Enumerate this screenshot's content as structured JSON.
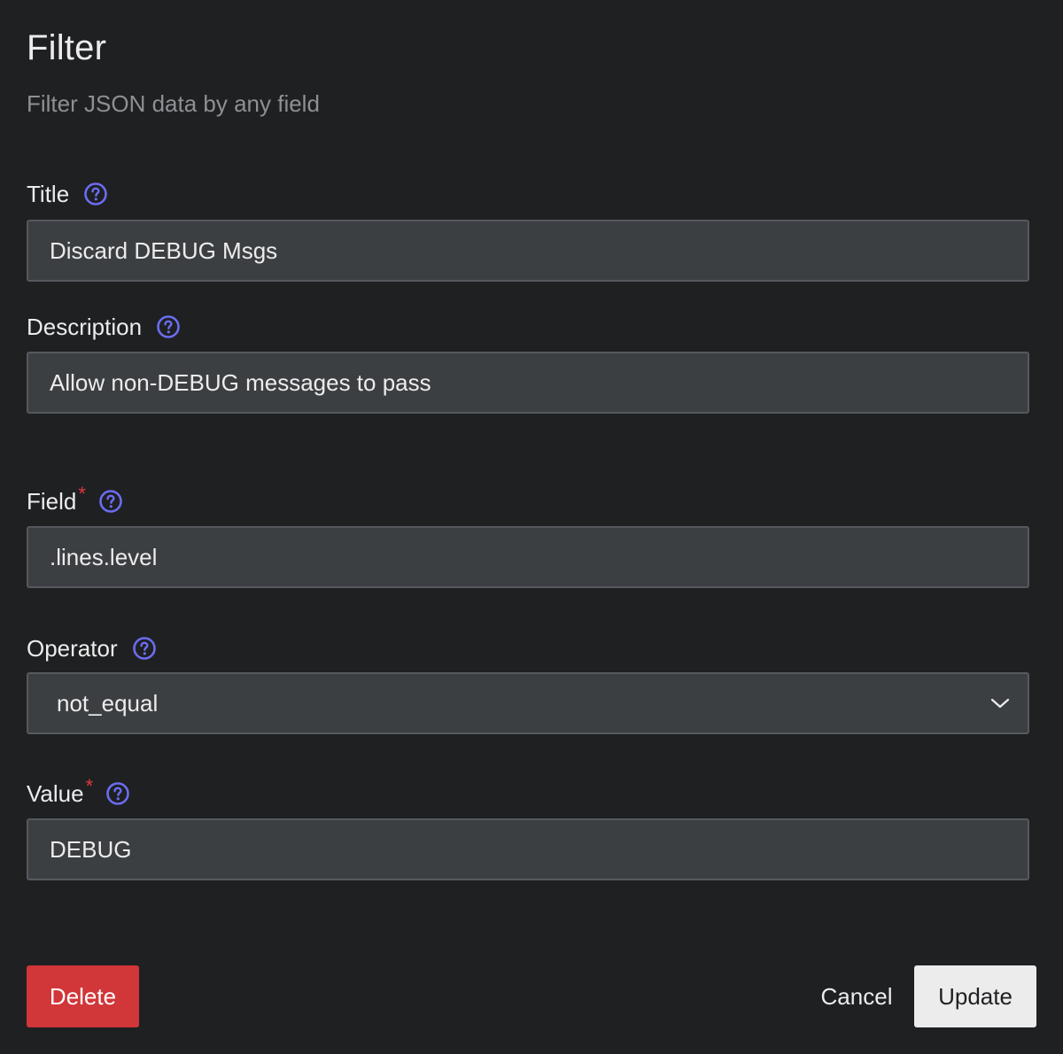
{
  "header": {
    "title": "Filter",
    "subtitle": "Filter JSON data by any field"
  },
  "form": {
    "title": {
      "label": "Title",
      "value": "Discard DEBUG Msgs",
      "help_icon": "help-circle-icon"
    },
    "description": {
      "label": "Description",
      "value": "Allow non-DEBUG messages to pass",
      "help_icon": "help-circle-icon"
    },
    "field": {
      "label": "Field",
      "required_mark": "*",
      "value": ".lines.level",
      "help_icon": "help-circle-icon"
    },
    "operator": {
      "label": "Operator",
      "selected": "not_equal",
      "help_icon": "help-circle-icon",
      "dropdown_icon": "chevron-down-icon"
    },
    "value": {
      "label": "Value",
      "required_mark": "*",
      "value": "DEBUG",
      "help_icon": "help-circle-icon"
    }
  },
  "actions": {
    "delete_label": "Delete",
    "cancel_label": "Cancel",
    "update_label": "Update"
  },
  "colors": {
    "background": "#1f2022",
    "input_bg": "#3c3f42",
    "input_border": "#55595e",
    "help_icon": "#6b6df2",
    "required": "#e0383e",
    "delete_bg": "#d13639",
    "update_bg": "#ececed"
  }
}
